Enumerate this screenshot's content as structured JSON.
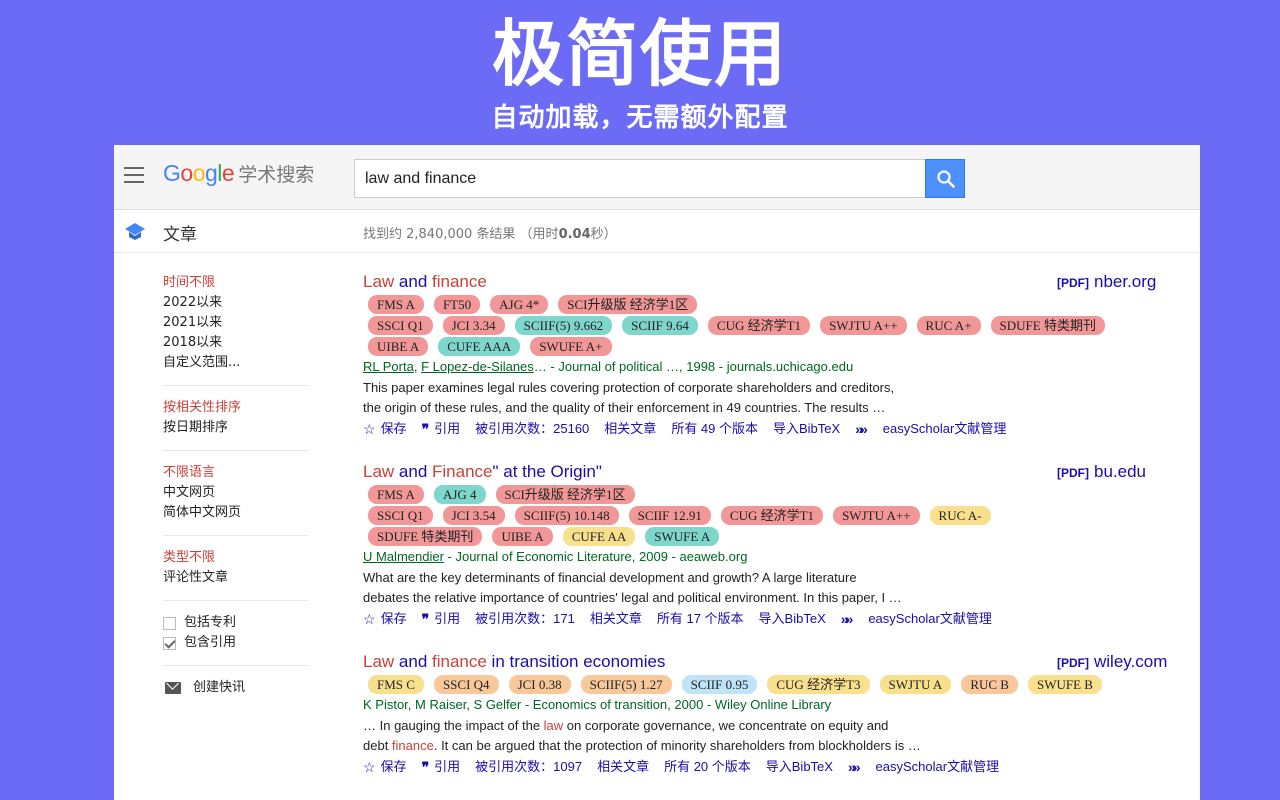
{
  "banner": {
    "title": "极简使用",
    "subtitle": "自动加载，无需额外配置"
  },
  "header": {
    "logo_google": [
      "G",
      "o",
      "o",
      "g",
      "l",
      "e"
    ],
    "logo_colors": [
      "#4285f4",
      "#ea4335",
      "#fbbc05",
      "#4285f4",
      "#34a853",
      "#ea4335"
    ],
    "logo_suffix": "学术搜索",
    "search_value": "law and finance"
  },
  "subbar": {
    "section": "文章",
    "stats_prefix": "找到约 2,840,000 条结果 （用时",
    "stats_time": "0.04",
    "stats_suffix": "秒）"
  },
  "sidebar": {
    "time": [
      "时间不限",
      "2022以来",
      "2021以来",
      "2018以来",
      "自定义范围..."
    ],
    "sort": [
      "按相关性排序",
      "按日期排序"
    ],
    "lang": [
      "不限语言",
      "中文网页",
      "简体中文网页"
    ],
    "type": [
      "类型不限",
      "评论性文章"
    ],
    "checks": [
      {
        "label": "包括专利",
        "checked": false
      },
      {
        "label": "包含引用",
        "checked": true
      }
    ],
    "alert": "创建快讯"
  },
  "results": [
    {
      "title": [
        {
          "t": "Law",
          "hl": true
        },
        {
          "t": " and ",
          "hl": false
        },
        {
          "t": "finance",
          "hl": true
        }
      ],
      "pdf_tag": "[PDF]",
      "pdf_domain": "nber.org",
      "badges": [
        [
          {
            "t": "FMS A",
            "c": "red"
          },
          {
            "t": "FT50",
            "c": "red"
          },
          {
            "t": "AJG 4*",
            "c": "red"
          },
          {
            "t": "SCI升级版 经济学1区",
            "c": "red"
          }
        ],
        [
          {
            "t": "SSCI Q1",
            "c": "red"
          },
          {
            "t": "JCI 3.34",
            "c": "red"
          },
          {
            "t": "SCIIF(5) 9.662",
            "c": "teal"
          },
          {
            "t": "SCIIF 9.64",
            "c": "teal"
          },
          {
            "t": "CUG 经济学T1",
            "c": "red"
          },
          {
            "t": "SWJTU A++",
            "c": "red"
          },
          {
            "t": "RUC A+",
            "c": "red"
          },
          {
            "t": "SDUFE 特类期刊",
            "c": "red"
          }
        ],
        [
          {
            "t": "UIBE A",
            "c": "red"
          },
          {
            "t": "CUFE AAA",
            "c": "teal"
          },
          {
            "t": "SWUFE A+",
            "c": "red"
          }
        ]
      ],
      "authors_links": [
        "RL Porta",
        "F Lopez-de-Silanes"
      ],
      "authors_rest": "… - Journal of political …, 1998 - journals.uchicago.edu",
      "snippet": [
        [
          {
            "t": "This paper examines legal rules covering protection of corporate shareholders and creditors,",
            "hl": false
          }
        ],
        [
          {
            "t": "the origin of these rules, and the quality of their enforcement in 49 countries. The results …",
            "hl": false
          }
        ]
      ],
      "actions": {
        "save": "保存",
        "cite": "引用",
        "cited": "被引用次数：25160",
        "related": "相关文章",
        "versions": "所有 49 个版本",
        "bibtex": "导入BibTeX",
        "easy": "easyScholar文献管理"
      }
    },
    {
      "title": [
        {
          "t": "Law",
          "hl": true
        },
        {
          "t": " and ",
          "hl": false
        },
        {
          "t": "Finance",
          "hl": true
        },
        {
          "t": "\" at the Origin\"",
          "hl": false
        }
      ],
      "pdf_tag": "[PDF]",
      "pdf_domain": "bu.edu",
      "badges": [
        [
          {
            "t": "FMS A",
            "c": "red"
          },
          {
            "t": "AJG 4",
            "c": "teal"
          },
          {
            "t": "SCI升级版 经济学1区",
            "c": "red"
          }
        ],
        [
          {
            "t": "SSCI Q1",
            "c": "red"
          },
          {
            "t": "JCI 3.54",
            "c": "red"
          },
          {
            "t": "SCIIF(5) 10.148",
            "c": "red"
          },
          {
            "t": "SCIIF 12.91",
            "c": "red"
          },
          {
            "t": "CUG 经济学T1",
            "c": "red"
          },
          {
            "t": "SWJTU A++",
            "c": "red"
          },
          {
            "t": "RUC A-",
            "c": "yellow"
          }
        ],
        [
          {
            "t": "SDUFE 特类期刊",
            "c": "red"
          },
          {
            "t": "UIBE A",
            "c": "red"
          },
          {
            "t": "CUFE AA",
            "c": "yellow"
          },
          {
            "t": "SWUFE A",
            "c": "teal"
          }
        ]
      ],
      "authors_links": [
        "U Malmendier"
      ],
      "authors_rest": " - Journal of Economic Literature, 2009 - aeaweb.org",
      "snippet": [
        [
          {
            "t": "What are the key determinants of financial development and growth? A large literature",
            "hl": false
          }
        ],
        [
          {
            "t": "debates the relative importance of countries' legal and political environment. In this paper, I …",
            "hl": false
          }
        ]
      ],
      "actions": {
        "save": "保存",
        "cite": "引用",
        "cited": "被引用次数：171",
        "related": "相关文章",
        "versions": "所有 17 个版本",
        "bibtex": "导入BibTeX",
        "easy": "easyScholar文献管理"
      }
    },
    {
      "title": [
        {
          "t": "Law",
          "hl": true
        },
        {
          "t": " and ",
          "hl": false
        },
        {
          "t": "finance",
          "hl": true
        },
        {
          "t": " in transition economies",
          "hl": false
        }
      ],
      "pdf_tag": "[PDF]",
      "pdf_domain": "wiley.com",
      "badges": [
        [
          {
            "t": "FMS C",
            "c": "yellow"
          },
          {
            "t": "SSCI Q4",
            "c": "orange"
          },
          {
            "t": "JCI 0.38",
            "c": "orange"
          },
          {
            "t": "SCIIF(5) 1.27",
            "c": "orange"
          },
          {
            "t": "SCIIF 0.95",
            "c": "blue"
          },
          {
            "t": "CUG 经济学T3",
            "c": "yellow"
          },
          {
            "t": "SWJTU A",
            "c": "yellow"
          },
          {
            "t": "RUC B",
            "c": "orange"
          },
          {
            "t": "SWUFE B",
            "c": "yellow"
          }
        ]
      ],
      "authors_links": [],
      "authors_rest": "K Pistor, M Raiser, S Gelfer - Economics of transition, 2000 - Wiley Online Library",
      "snippet": [
        [
          {
            "t": "… In gauging the impact of the ",
            "hl": false
          },
          {
            "t": "law",
            "hl": true
          },
          {
            "t": " on corporate governance, we concentrate on equity and",
            "hl": false
          }
        ],
        [
          {
            "t": "debt ",
            "hl": false
          },
          {
            "t": "finance",
            "hl": true
          },
          {
            "t": ". It can be argued that the protection of minority shareholders from blockholders is …",
            "hl": false
          }
        ]
      ],
      "actions": {
        "save": "保存",
        "cite": "引用",
        "cited": "被引用次数：1097",
        "related": "相关文章",
        "versions": "所有 20 个版本",
        "bibtex": "导入BibTeX",
        "easy": "easyScholar文献管理"
      }
    }
  ],
  "colors": {
    "background": "#6b6bf5",
    "link": "#1a0dab",
    "highlight": "#c8423a",
    "author": "#006621",
    "search_button": "#4d90fe"
  },
  "icons": {
    "menu": "hamburger-icon",
    "scholar": "graduation-cap-icon",
    "search": "search-icon",
    "save": "star-icon",
    "cite": "quote-icon",
    "more": "double-chevron-icon",
    "alert": "mail-icon"
  }
}
